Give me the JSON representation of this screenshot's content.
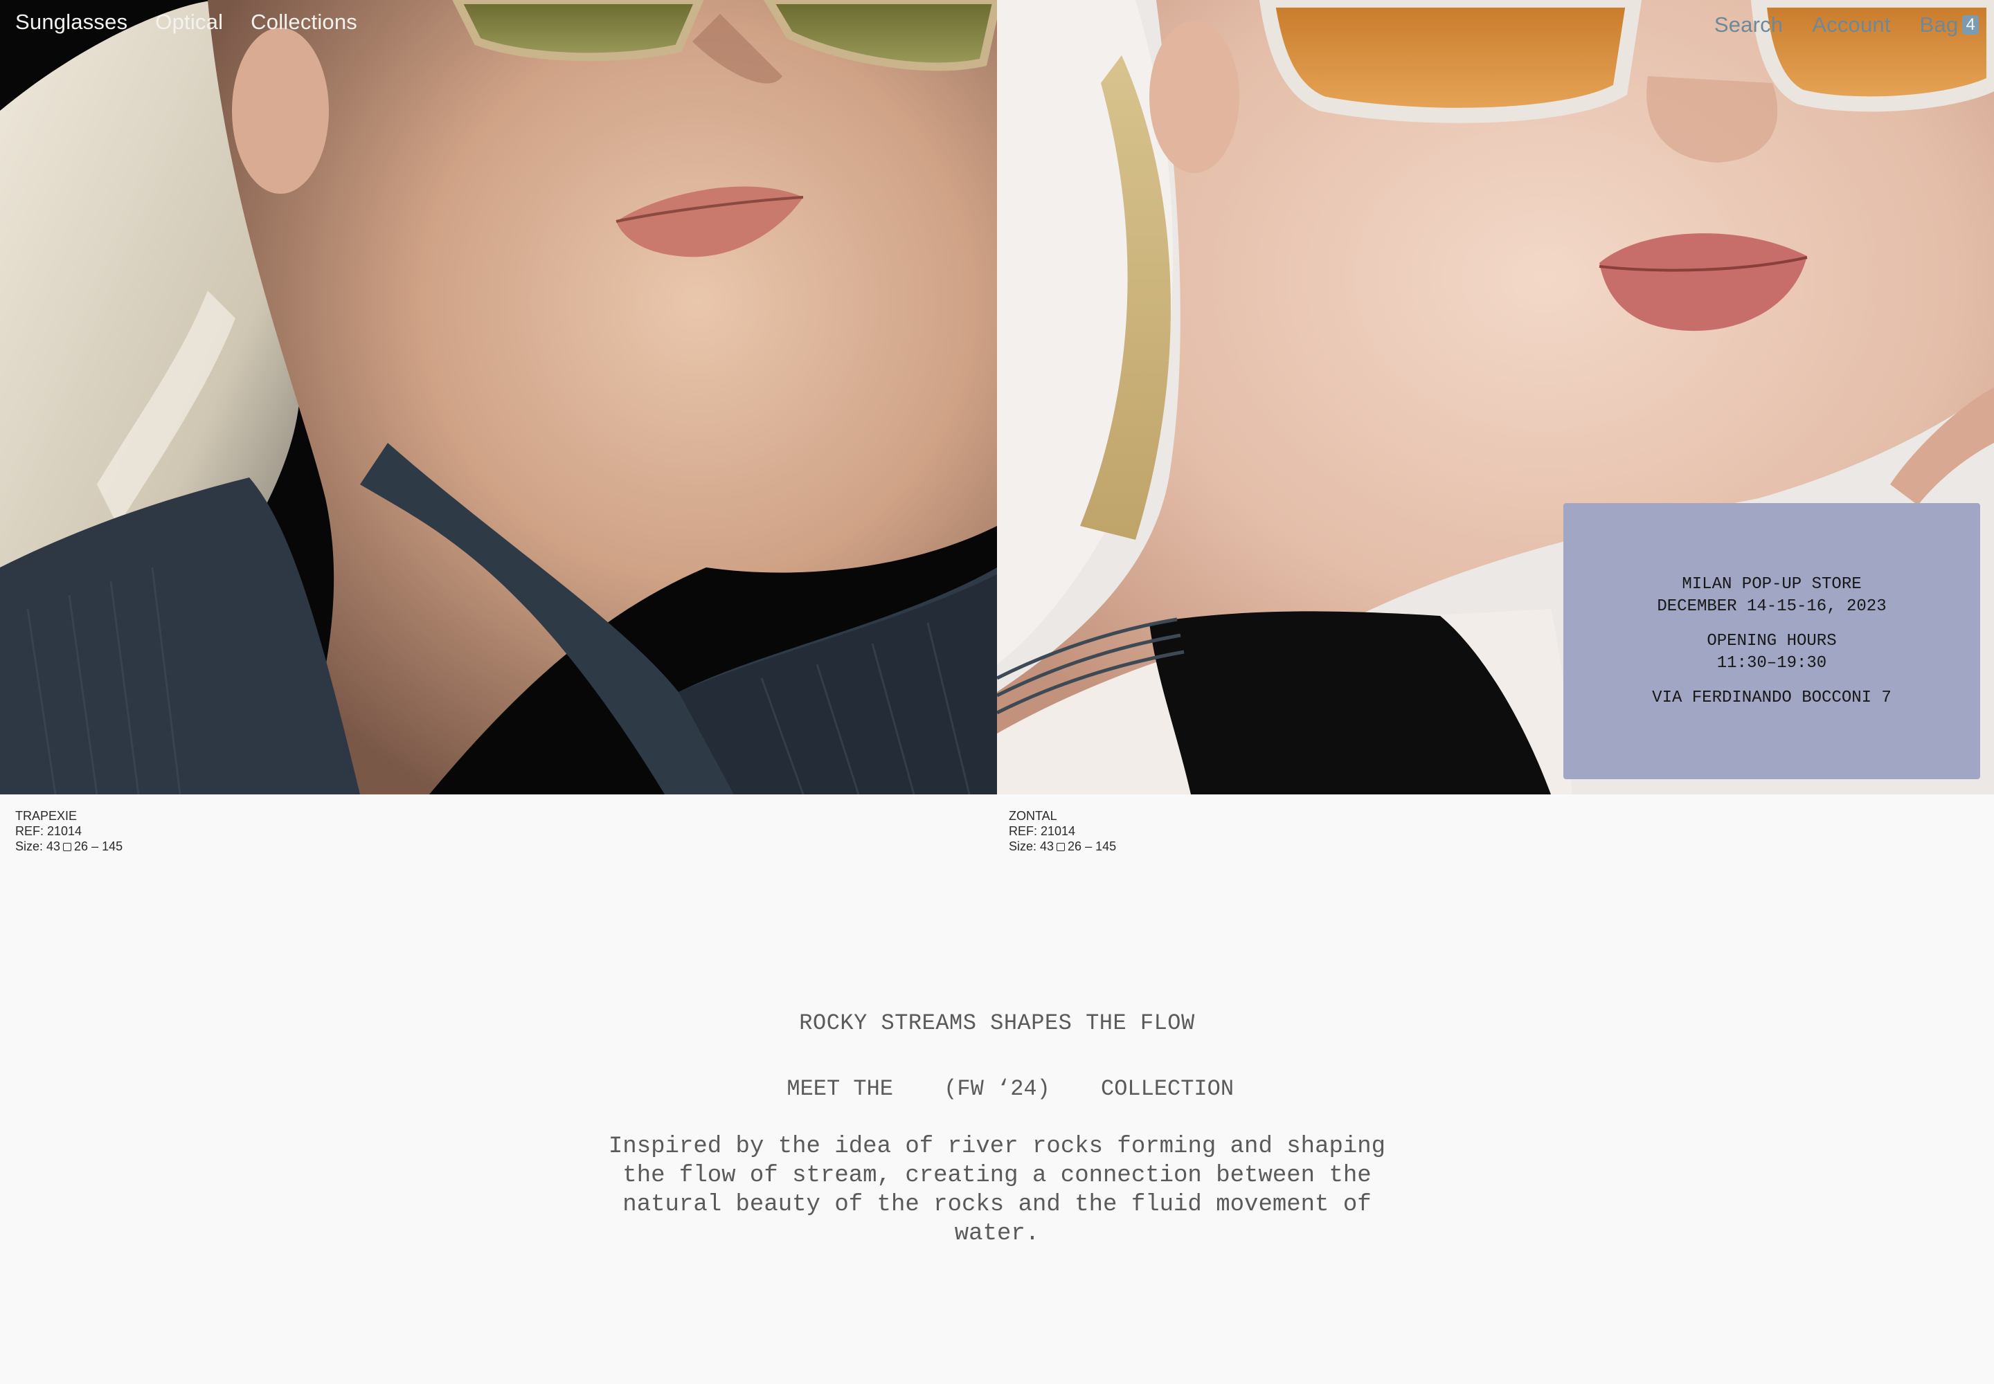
{
  "nav": {
    "left": [
      "Sunglasses",
      "Optical",
      "Collections"
    ],
    "search": "Search",
    "account": "Account",
    "bag_label": "Bag",
    "bag_count": "4"
  },
  "popup": {
    "line1": "MILAN POP-UP STORE",
    "line2": "DECEMBER 14-15-16, 2023",
    "line3": "OPENING HOURS",
    "line4": "11:30–19:30",
    "line5": "VIA FERDINANDO BOCCONI 7"
  },
  "products": [
    {
      "name": "TRAPEXIE",
      "ref": "REF: 21014",
      "size_prefix": "Size: 43",
      "size_suffix": "26 – 145"
    },
    {
      "name": "ZONTAL",
      "ref": "REF: 21014",
      "size_prefix": "Size: 43",
      "size_suffix": "26 – 145"
    }
  ],
  "intro": {
    "headline": "ROCKY STREAMS SHAPES THE FLOW",
    "meet_1": "MEET THE",
    "meet_2": "(FW ‘24)",
    "meet_3": "COLLECTION",
    "description": "Inspired by the idea of river rocks forming and shaping the flow of stream, creating a connection between the natural beauty of the rocks and the fluid movement of water."
  },
  "colors": {
    "background": "#f9f9f9",
    "popup_bg": "#a0a6c4",
    "nav_right": "#6f8898",
    "bag_badge": "#7c9bb0"
  }
}
